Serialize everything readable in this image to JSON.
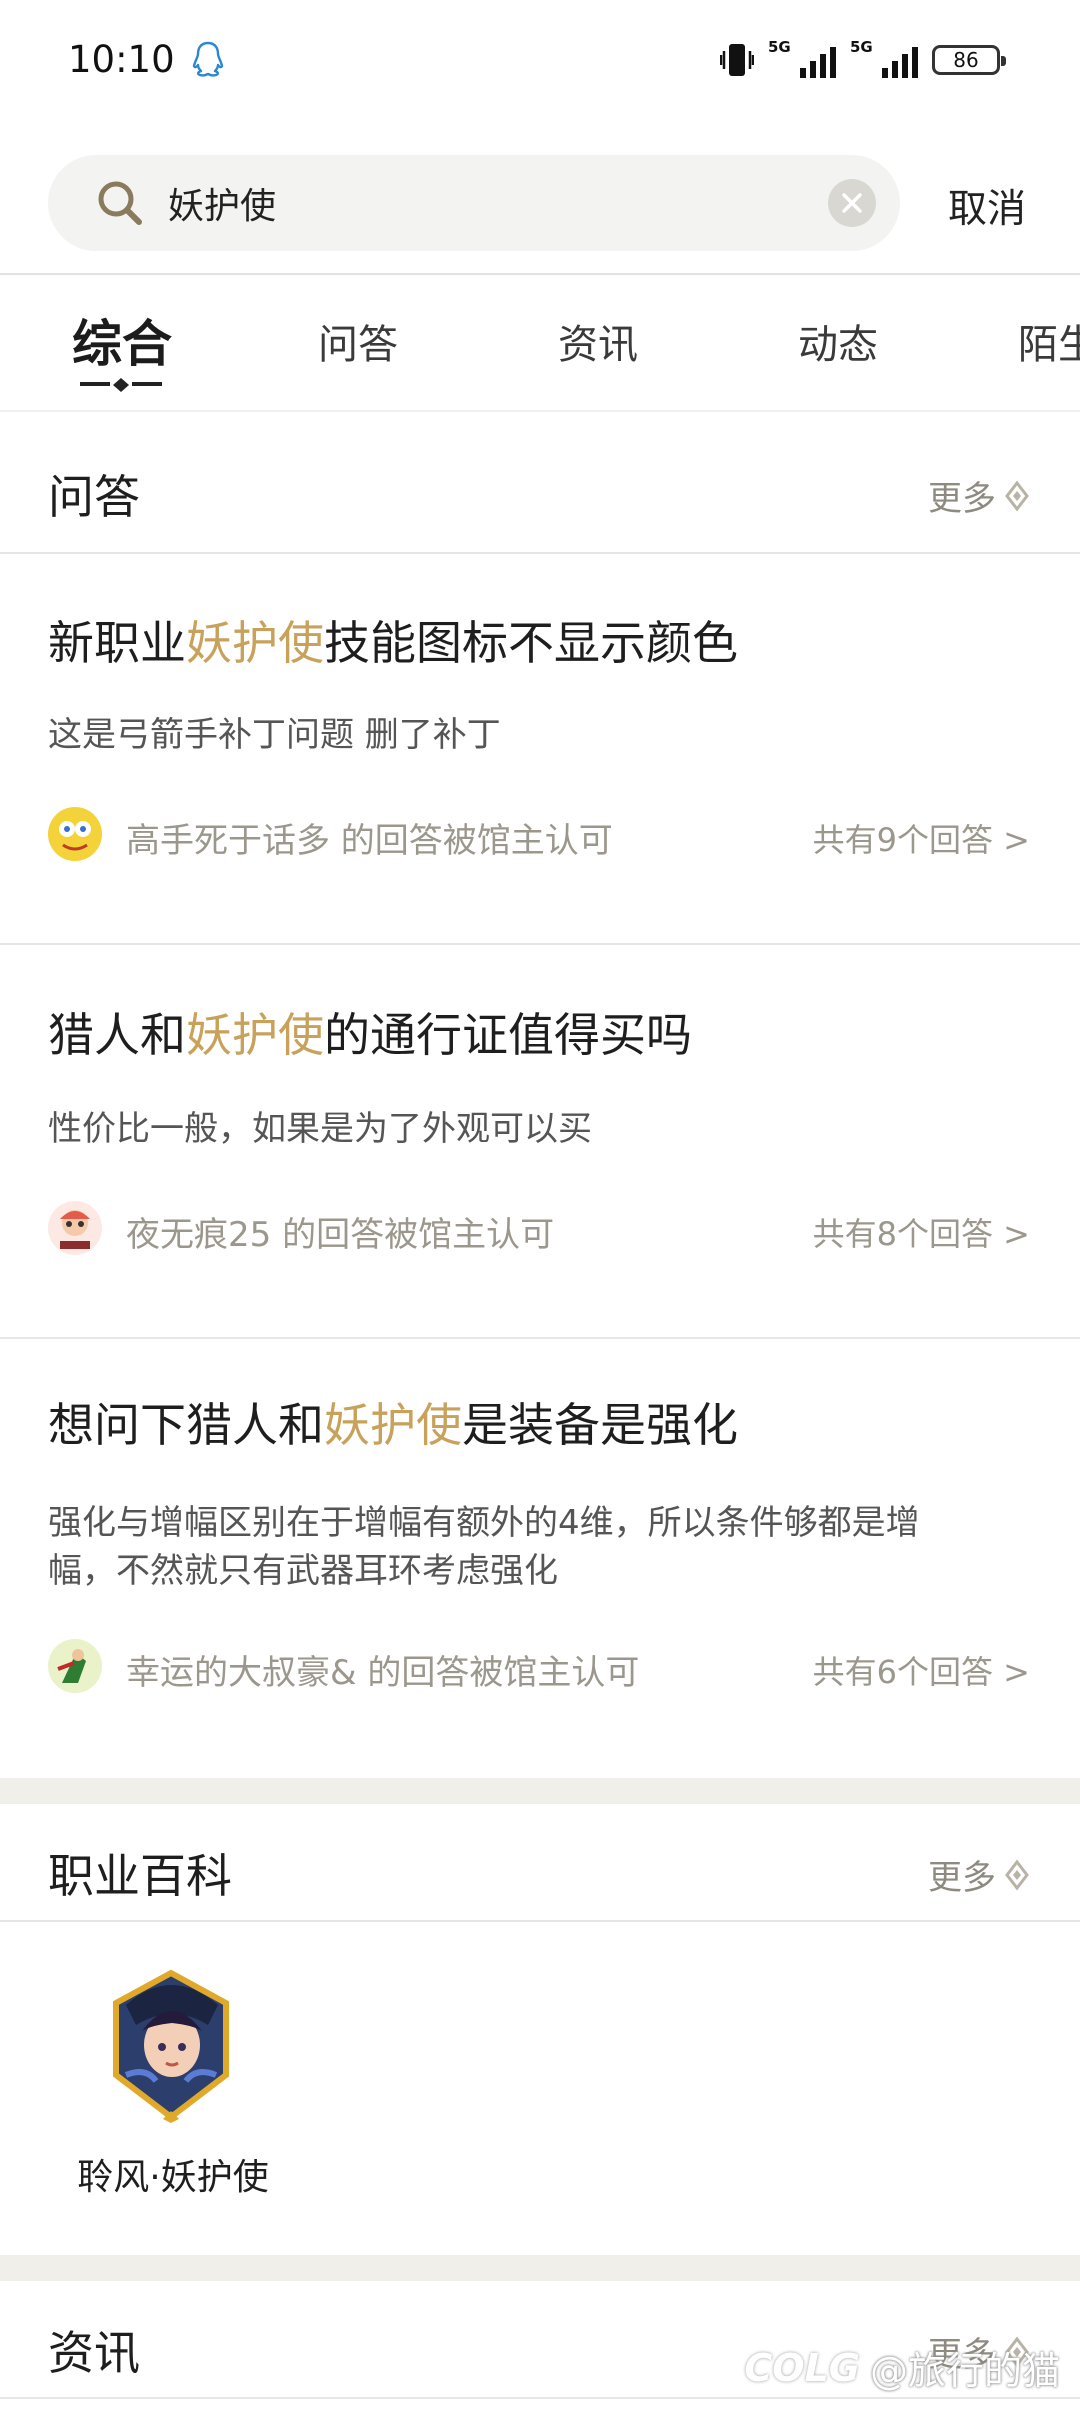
{
  "status_bar": {
    "time": "10:10",
    "signal1_label": "5G",
    "signal2_label": "5G",
    "battery": "86",
    "icons": [
      "qq-icon",
      "vibrate-icon",
      "signal-icon",
      "signal-icon",
      "battery-icon"
    ]
  },
  "search": {
    "value": "妖护使",
    "cancel_label": "取消"
  },
  "tabs": [
    {
      "label": "综合",
      "active": true
    },
    {
      "label": "问答",
      "active": false
    },
    {
      "label": "资讯",
      "active": false
    },
    {
      "label": "动态",
      "active": false
    },
    {
      "label": "陌生",
      "active": false
    }
  ],
  "qa_section": {
    "title": "问答",
    "more_label": "更多",
    "items": [
      {
        "title_before": "新职业",
        "title_highlight": "妖护使",
        "title_after": "技能图标不显示颜色",
        "answer": "这是弓箭手补丁问题  删了补丁",
        "user_text": "高手死于话多  的回答被馆主认可",
        "count_text": "共有9个回答 >"
      },
      {
        "title_before": "猎人和",
        "title_highlight": "妖护使",
        "title_after": "的通行证值得买吗",
        "answer": "性价比一般，如果是为了外观可以买",
        "user_text": "夜无痕25  的回答被馆主认可",
        "count_text": "共有8个回答 >"
      },
      {
        "title_before": "想问下猎人和",
        "title_highlight": "妖护使",
        "title_after": "是装备是强化",
        "answer": "强化与增幅区别在于增幅有额外的4维，所以条件够都是增幅，不然就只有武器耳环考虑强化",
        "user_text": "幸运的大叔豪&  的回答被馆主认可",
        "count_text": "共有6个回答 >"
      }
    ]
  },
  "encyclopedia_section": {
    "title": "职业百科",
    "more_label": "更多",
    "hero_name": "聆风·妖护使"
  },
  "news_section": {
    "title": "资讯",
    "more_label": "更多"
  },
  "watermark": {
    "logo": "COLG",
    "text": "@旅行的猫"
  },
  "colors": {
    "highlight": "#c8a25a",
    "muted": "#9c978c",
    "band": "#f1efea"
  }
}
